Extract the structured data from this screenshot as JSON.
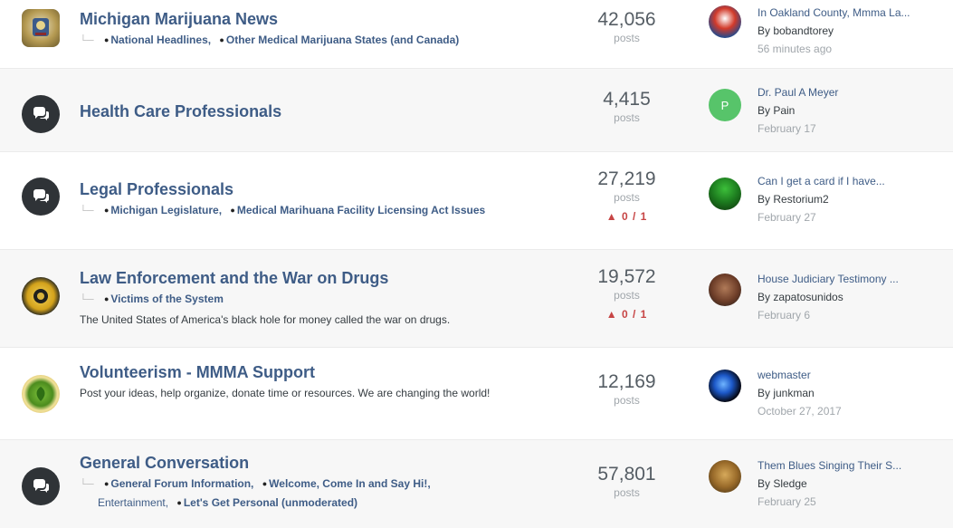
{
  "forums": [
    {
      "title": "Michigan Marijuana News",
      "icon": "michigan-seal-icon",
      "subforums": [
        "National Headlines,",
        "Other Medical Marijuana States (and Canada)"
      ],
      "description": "",
      "posts": "42,056",
      "posts_label": "posts",
      "warn": "",
      "last_topic": "In Oakland County, Mmma La...",
      "last_by": "By bobandtorey",
      "last_date": "56 minutes ago"
    },
    {
      "title": "Health Care Professionals",
      "icon": "chat-bubble-icon",
      "subforums": [],
      "description": "",
      "posts": "4,415",
      "posts_label": "posts",
      "warn": "",
      "avatar_letter": "P",
      "last_topic": "Dr. Paul A Meyer",
      "last_by": "By Pain",
      "last_date": "February 17"
    },
    {
      "title": "Legal Professionals",
      "icon": "chat-bubble-icon",
      "subforums": [
        "Michigan Legislature,",
        "Medical Marihuana Facility Licensing Act Issues"
      ],
      "description": "",
      "posts": "27,219",
      "posts_label": "posts",
      "warn": "0 / 1",
      "last_topic": "Can I get a card if I have...",
      "last_by": "By Restorium2",
      "last_date": "February 27"
    },
    {
      "title": "Law Enforcement and the War on Drugs",
      "icon": "police-badge-icon",
      "subforums": [
        "Victims of the System"
      ],
      "description": "The United States of America's black hole for money called the war on drugs.",
      "posts": "19,572",
      "posts_label": "posts",
      "warn": "0 / 1",
      "last_topic": "House Judiciary Testimony ...",
      "last_by": "By zapatosunidos",
      "last_date": "February 6"
    },
    {
      "title": "Volunteerism - MMMA Support",
      "icon": "leaf-seal-icon",
      "subforums": [],
      "description": "Post your ideas, help organize, donate time or resources. We are changing the world!",
      "posts": "12,169",
      "posts_label": "posts",
      "warn": "",
      "last_topic": "webmaster",
      "last_by": "By junkman",
      "last_date": "October 27, 2017"
    },
    {
      "title": "General Conversation",
      "icon": "chat-bubble-icon",
      "subforums": [
        "General Forum Information,",
        "Welcome, Come In and Say Hi!,",
        "Entertainment,",
        "Let's Get Personal (unmoderated)"
      ],
      "description": "",
      "posts": "57,801",
      "posts_label": "posts",
      "warn": "",
      "last_topic": "Them Blues Singing Their S...",
      "last_by": "By Sledge",
      "last_date": "February 25"
    }
  ],
  "colors": {
    "link": "#3e5c86",
    "warn": "#c74545",
    "muted": "#a0a6ab"
  }
}
